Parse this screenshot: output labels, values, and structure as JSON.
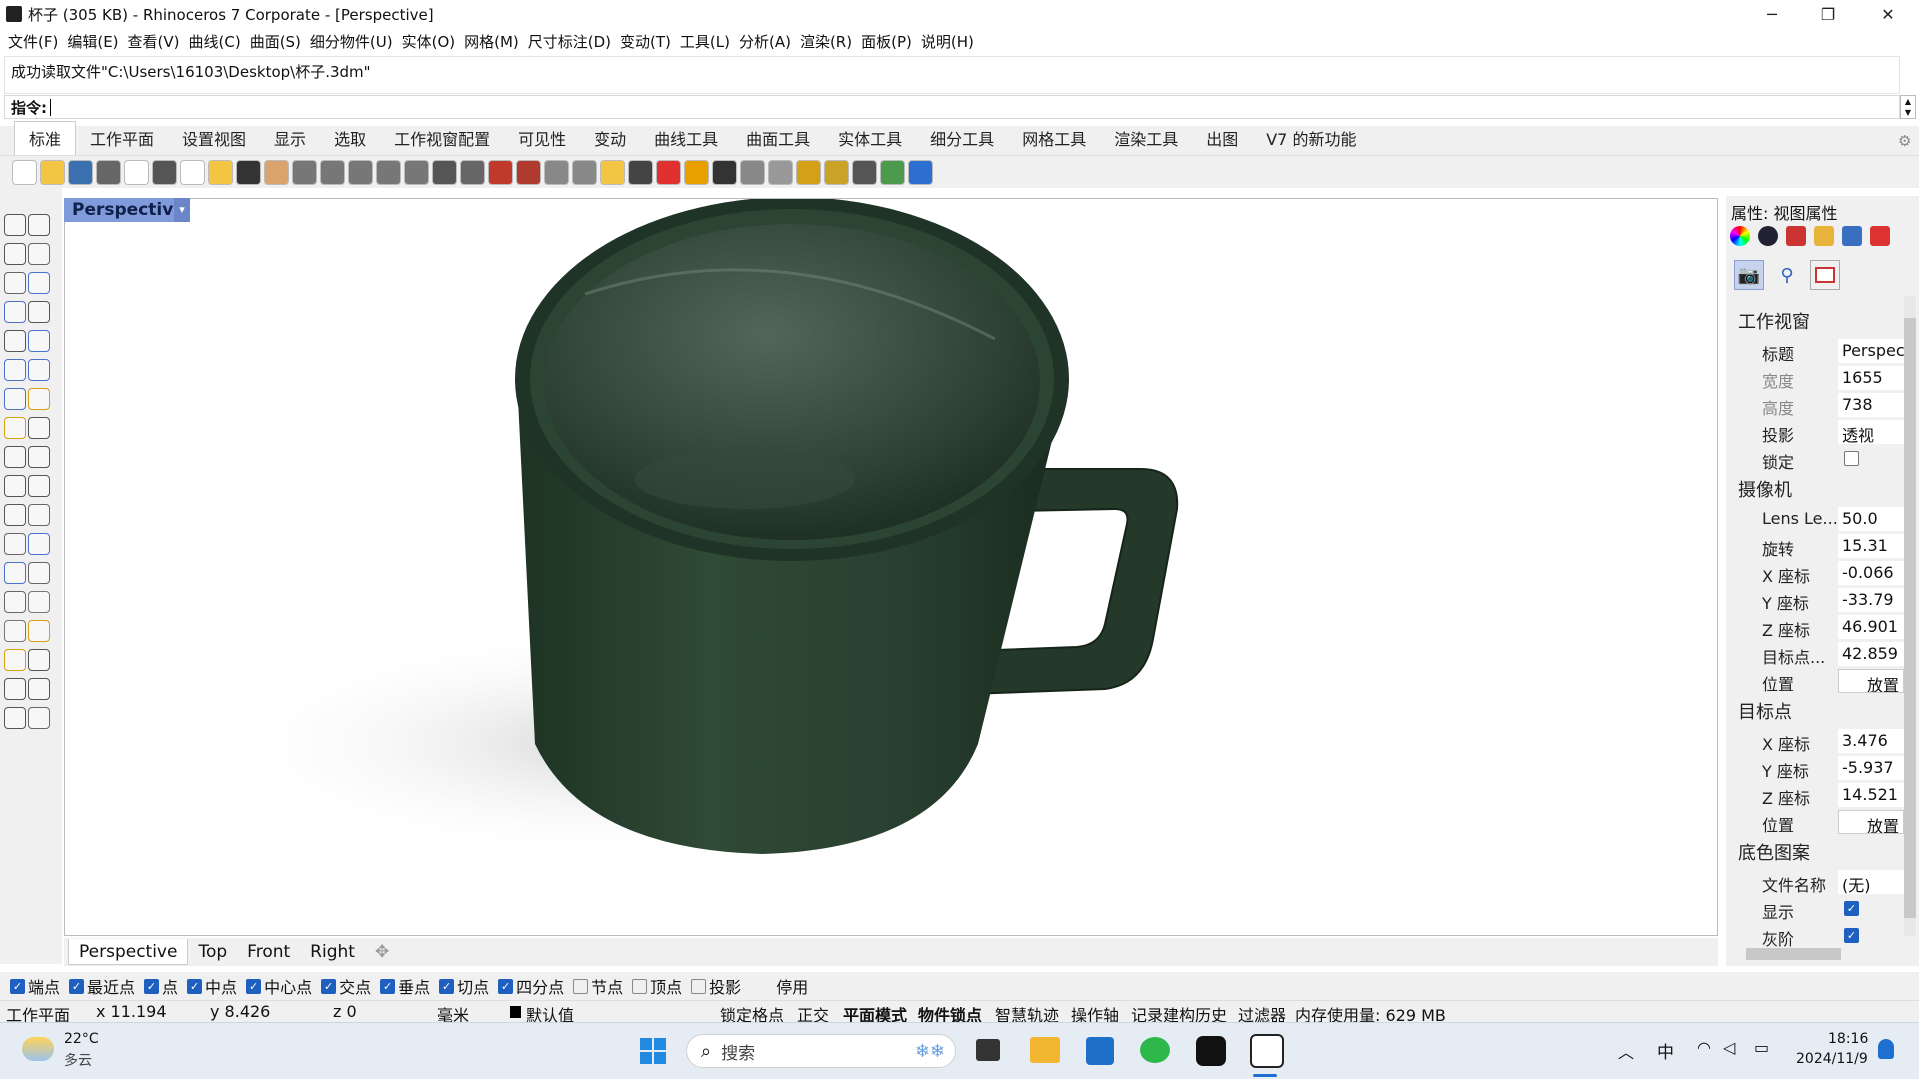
{
  "window": {
    "title": "杯子 (305 KB) - Rhinoceros 7 Corporate - [Perspective]",
    "minimize": "─",
    "restore": "❐",
    "close": "✕"
  },
  "menu": [
    "文件(F)",
    "编辑(E)",
    "查看(V)",
    "曲线(C)",
    "曲面(S)",
    "细分物件(U)",
    "实体(O)",
    "网格(M)",
    "尺寸标注(D)",
    "变动(T)",
    "工具(L)",
    "分析(A)",
    "渲染(R)",
    "面板(P)",
    "说明(H)"
  ],
  "command": {
    "history": "成功读取文件\"C:\\Users\\16103\\Desktop\\杯子.3dm\"",
    "prompt": "指令:"
  },
  "tabs": [
    "标准",
    "工作平面",
    "设置视图",
    "显示",
    "选取",
    "工作视窗配置",
    "可见性",
    "变动",
    "曲线工具",
    "曲面工具",
    "实体工具",
    "细分工具",
    "网格工具",
    "渲染工具",
    "出图",
    "V7 的新功能"
  ],
  "active_tab": 0,
  "toolbar_icons": [
    "new-file-icon",
    "open-icon",
    "save-icon",
    "print-icon",
    "import-icon",
    "cut-icon",
    "copy-icon",
    "paste-icon",
    "undo-icon",
    "pan-hand-icon",
    "move-view-icon",
    "zoom-icon",
    "zoom-window-icon",
    "zoom-extents-icon",
    "zoom-selected-icon",
    "rotate-view-icon",
    "four-views-icon",
    "car-icon",
    "car2-icon",
    "circle-icon",
    "grid-icon",
    "light-icon",
    "lock-icon",
    "layer-icon",
    "color-wheel-icon",
    "sphere-icon",
    "render-icon",
    "render2-icon",
    "brush-icon",
    "gear-icon",
    "snap-icon",
    "globe-icon",
    "help-icon"
  ],
  "toolbar_colors": [
    "#ffffff",
    "#f4c542",
    "#3a6fb0",
    "#666666",
    "#ffffff",
    "#555555",
    "#ffffff",
    "#f4c542",
    "#333333",
    "#d9a36b",
    "#777777",
    "#777777",
    "#777777",
    "#777777",
    "#777777",
    "#555555",
    "#666666",
    "#c0392b",
    "#b03a2e",
    "#888888",
    "#888888",
    "#f4c542",
    "#444444",
    "#e03030",
    "#e8a000",
    "#333333",
    "#888888",
    "#999999",
    "#d4a017",
    "#c9a227",
    "#555555",
    "#4c9a4c",
    "#2c6fd0"
  ],
  "viewport": {
    "label": "Perspective",
    "dropdown": "▾",
    "tabs": [
      "Perspective",
      "Top",
      "Front",
      "Right"
    ],
    "add": "✥"
  },
  "osnaps": [
    {
      "label": "端点",
      "on": true
    },
    {
      "label": "最近点",
      "on": true
    },
    {
      "label": "点",
      "on": true
    },
    {
      "label": "中点",
      "on": true
    },
    {
      "label": "中心点",
      "on": true
    },
    {
      "label": "交点",
      "on": true
    },
    {
      "label": "垂点",
      "on": true
    },
    {
      "label": "切点",
      "on": true
    },
    {
      "label": "四分点",
      "on": true
    },
    {
      "label": "节点",
      "on": false
    },
    {
      "label": "顶点",
      "on": false
    },
    {
      "label": "投影",
      "on": false
    },
    {
      "label": "停用",
      "on": false
    }
  ],
  "status": {
    "cplane": "工作平面",
    "x": "x 11.194",
    "y": "y 8.426",
    "z": "z 0",
    "unit": "毫米",
    "layer": "默认值",
    "grid_snap": "锁定格点",
    "ortho": "正交",
    "planar": "平面模式",
    "osnap": "物件锁点",
    "smarttrack": "智慧轨迹",
    "gumball": "操作轴",
    "history": "记录建构历史",
    "filter": "过滤器",
    "memory": "内存使用量: 629 MB"
  },
  "panel": {
    "header": "属性: 视图属性",
    "sec_viewport": "工作视窗",
    "title_k": "标题",
    "title_v": "Perspec",
    "width_k": "宽度",
    "width_v": "1655",
    "height_k": "高度",
    "height_v": "738",
    "proj_k": "投影",
    "proj_v": "透视",
    "lock_k": "锁定",
    "sec_camera": "摄像机",
    "lens_k": "Lens Le...",
    "lens_v": "50.0",
    "rot_k": "旋转",
    "rot_v": "15.31",
    "cx_k": "X 座标",
    "cx_v": "-0.066",
    "cy_k": "Y 座标",
    "cy_v": "-33.79",
    "cz_k": "Z 座标",
    "cz_v": "46.901",
    "tgt_k": "目标点...",
    "tgt_v": "42.859",
    "pos_k": "位置",
    "place": "放置",
    "sec_target": "目标点",
    "tx_k": "X 座标",
    "tx_v": "3.476",
    "ty_k": "Y 座标",
    "ty_v": "-5.937",
    "tz_k": "Z 座标",
    "tz_v": "14.521",
    "tpos_k": "位置",
    "sec_wallpaper": "底色图案",
    "file_k": "文件名称",
    "file_v": "(无)",
    "show_k": "显示",
    "gray_k": "灰阶"
  },
  "taskbar": {
    "temp": "22°C",
    "weather": "多云",
    "search": "搜索",
    "ime": "中",
    "time": "18:16",
    "date": "2024/11/9"
  }
}
